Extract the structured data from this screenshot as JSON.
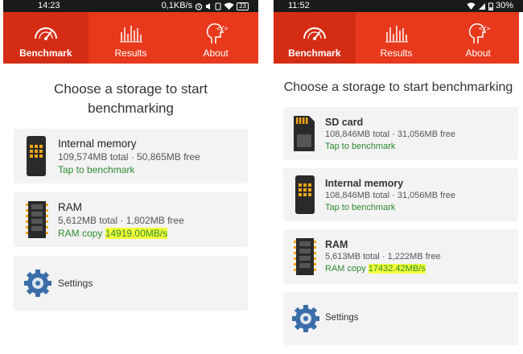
{
  "left": {
    "status": {
      "time": "14:23",
      "net": "0,1KB/s",
      "battery": "23"
    },
    "tabs": [
      {
        "label": "Benchmark"
      },
      {
        "label": "Results"
      },
      {
        "label": "About"
      }
    ],
    "title": "Choose a storage to start benchmarking",
    "internal": {
      "name": "Internal memory",
      "total": "109,574MB total · 50,865MB free",
      "tap": "Tap to benchmark"
    },
    "ram": {
      "name": "RAM",
      "total": "5,612MB total · 1,802MB free",
      "copy_label": "RAM copy ",
      "copy_value": "14919.00MB/s"
    },
    "settings": {
      "label": "Settings"
    }
  },
  "right": {
    "status": {
      "time": "11:52",
      "battery": "30%"
    },
    "tabs": [
      {
        "label": "Benchmark"
      },
      {
        "label": "Results"
      },
      {
        "label": "About"
      }
    ],
    "title": "Choose a storage to start benchmarking",
    "sdcard": {
      "name": "SD card",
      "total": "108,846MB total · 31,056MB free",
      "tap": "Tap to benchmark"
    },
    "internal": {
      "name": "Internal memory",
      "total": "108,846MB total · 31,056MB free",
      "tap": "Tap to benchmark"
    },
    "ram": {
      "name": "RAM",
      "total": "5,613MB total · 1,222MB free",
      "copy_label": "RAM copy ",
      "copy_value": "17432.42MB/s"
    },
    "settings": {
      "label": "Settings"
    }
  },
  "colors": {
    "toolbar": "#e8391c",
    "toolbar_active": "#d42d14",
    "tap_green": "#2e8b30",
    "highlight": "#f3ff3a"
  }
}
